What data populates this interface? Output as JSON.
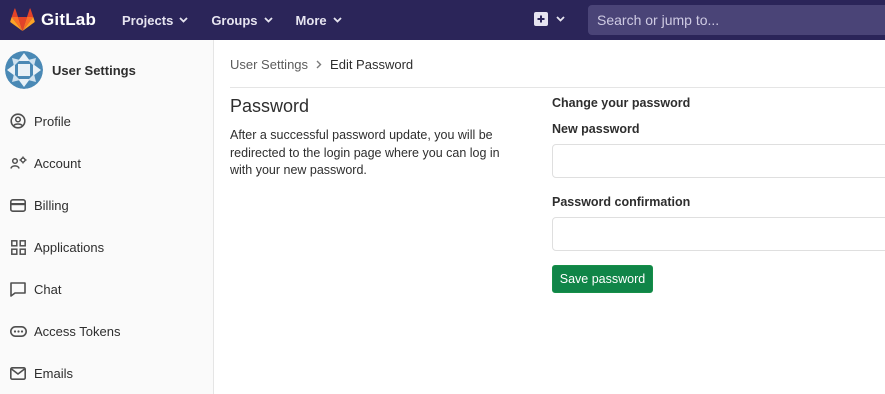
{
  "navbar": {
    "brand": "GitLab",
    "menu": [
      {
        "label": "Projects"
      },
      {
        "label": "Groups"
      },
      {
        "label": "More"
      }
    ],
    "search_placeholder": "Search or jump to..."
  },
  "sidebar": {
    "title": "User Settings",
    "items": [
      {
        "label": "Profile",
        "icon": "profile-icon"
      },
      {
        "label": "Account",
        "icon": "account-icon"
      },
      {
        "label": "Billing",
        "icon": "billing-icon"
      },
      {
        "label": "Applications",
        "icon": "applications-icon"
      },
      {
        "label": "Chat",
        "icon": "chat-icon"
      },
      {
        "label": "Access Tokens",
        "icon": "access-tokens-icon"
      },
      {
        "label": "Emails",
        "icon": "emails-icon"
      }
    ]
  },
  "breadcrumb": {
    "parent": "User Settings",
    "current": "Edit Password"
  },
  "section": {
    "title": "Password",
    "description": "After a successful password update, you will be redirected to the login page where you can log in with your new password."
  },
  "form": {
    "heading": "Change your password",
    "new_password_label": "New password",
    "new_password_value": "",
    "confirmation_label": "Password confirmation",
    "confirmation_value": "",
    "save_label": "Save password"
  },
  "colors": {
    "navbar_bg": "#2b2559",
    "brand_orange": "#fc6d26",
    "save_button": "#108548"
  }
}
